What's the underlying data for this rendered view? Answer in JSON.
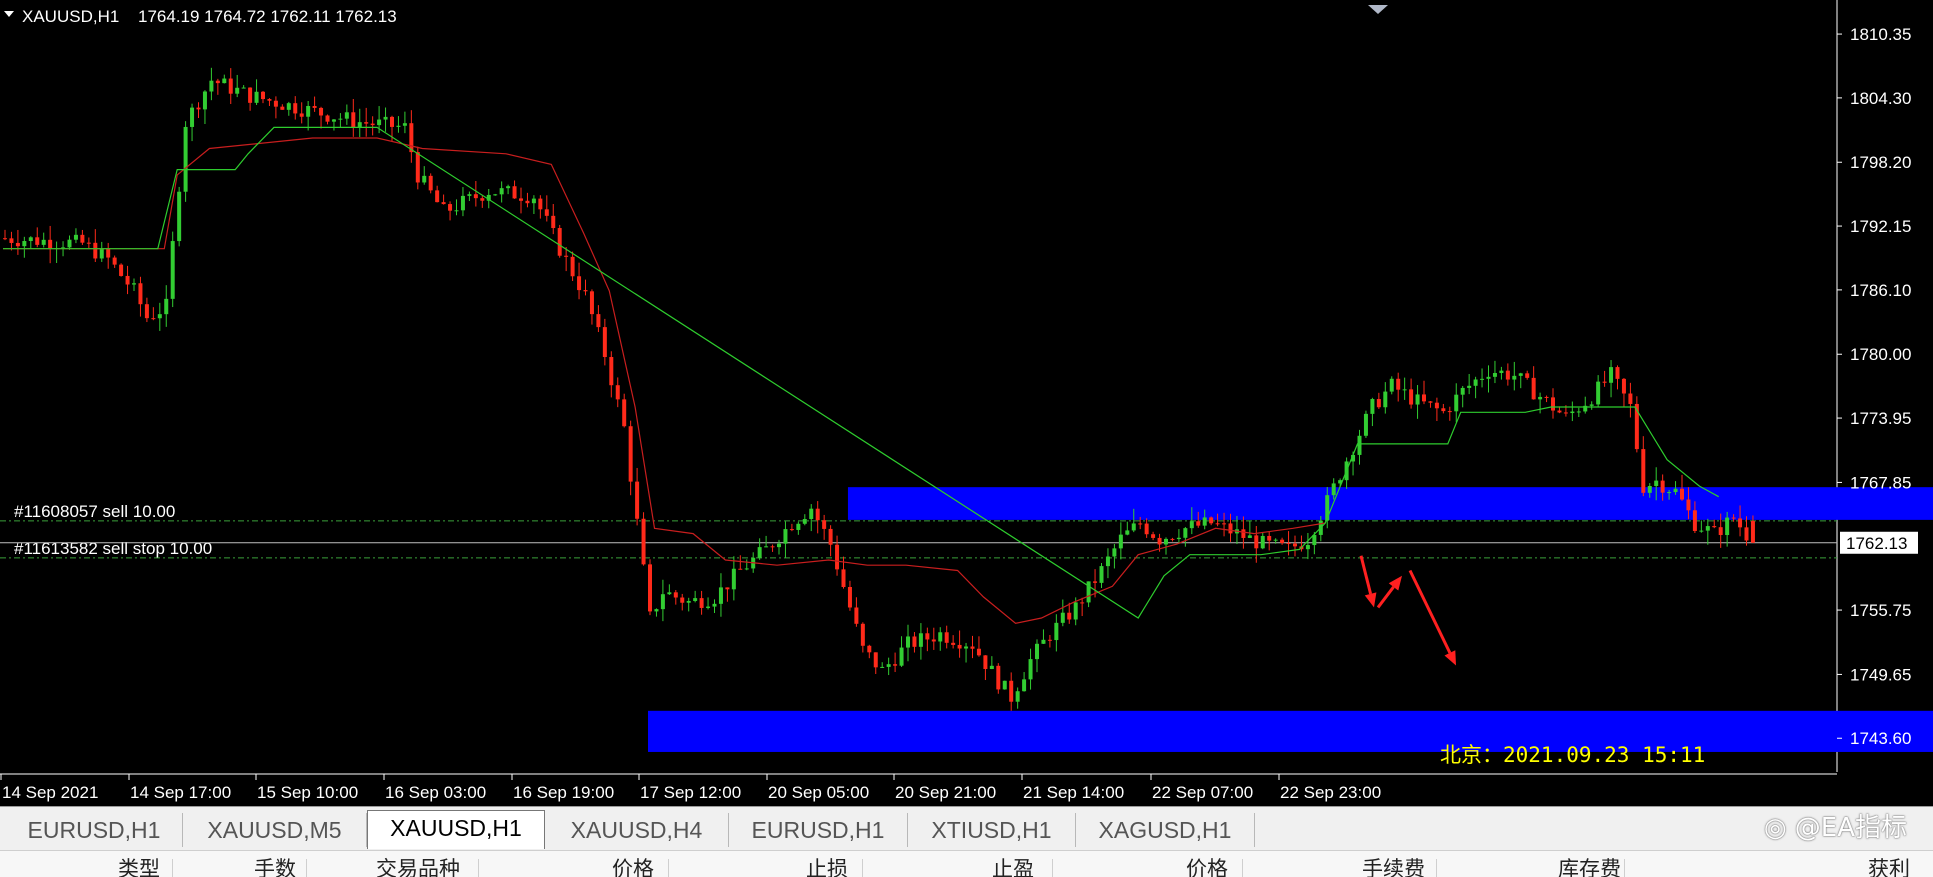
{
  "header": {
    "symbol": "XAUUSD,H1",
    "ohlc": "1764.19 1764.72 1762.11 1762.13"
  },
  "orders": [
    {
      "label": "#11608057 sell 10.00",
      "price": 1764.2
    },
    {
      "label": "#11613582 sell stop 10.00",
      "price": 1760.7
    }
  ],
  "current_price_label": "1762.13",
  "beijing_time": "北京：2021.09.23 15:11",
  "tabs": [
    {
      "label": "EURUSD,H1",
      "active": false
    },
    {
      "label": "XAUUSD,M5",
      "active": false
    },
    {
      "label": "XAUUSD,H1",
      "active": true
    },
    {
      "label": "XAUUSD,H4",
      "active": false
    },
    {
      "label": "EURUSD,H1",
      "active": false
    },
    {
      "label": "XTIUSD,H1",
      "active": false
    },
    {
      "label": "XAGUSD,H1",
      "active": false
    }
  ],
  "watermark": "@EA指标",
  "terminal_columns": [
    "类型",
    "手数",
    "交易品种",
    "价格",
    "止损",
    "止盈",
    "价格",
    "手续费",
    "库存费",
    "获利"
  ],
  "colors": {
    "background": "#000000",
    "bull": "#32cd32",
    "bear": "#ff2a1a",
    "zone": "#0000ff",
    "arrow": "#ff2020",
    "ma_red": "#c81e1e",
    "ma_green": "#2ecc2e"
  },
  "chart_data": {
    "type": "candlestick",
    "symbol": "XAUUSD",
    "timeframe": "H1",
    "ylim": [
      1740.4,
      1813.2
    ],
    "y_ticks": [
      1810.35,
      1804.3,
      1798.2,
      1792.15,
      1786.1,
      1780.0,
      1773.95,
      1767.85,
      1762.13,
      1755.75,
      1749.65,
      1743.6
    ],
    "x_tick_labels": [
      "14 Sep 2021",
      "14 Sep 17:00",
      "15 Sep 10:00",
      "16 Sep 03:00",
      "16 Sep 19:00",
      "17 Sep 12:00",
      "20 Sep 05:00",
      "20 Sep 21:00",
      "21 Sep 14:00",
      "22 Sep 07:00",
      "22 Sep 23:00"
    ],
    "close_path": [
      [
        0,
        1791.0
      ],
      [
        12,
        1790.5
      ],
      [
        16,
        1789.0
      ],
      [
        20,
        1786.0
      ],
      [
        22,
        1783.5
      ],
      [
        25,
        1784.5
      ],
      [
        28,
        1802.0
      ],
      [
        32,
        1806.0
      ],
      [
        38,
        1804.5
      ],
      [
        48,
        1803.0
      ],
      [
        55,
        1802.0
      ],
      [
        62,
        1801.5
      ],
      [
        64,
        1797.0
      ],
      [
        68,
        1793.5
      ],
      [
        75,
        1795.5
      ],
      [
        82,
        1795.0
      ],
      [
        86,
        1790.0
      ],
      [
        90,
        1785.5
      ],
      [
        93,
        1780.0
      ],
      [
        96,
        1773.0
      ],
      [
        98,
        1764.0
      ],
      [
        100,
        1755.0
      ],
      [
        102,
        1757.5
      ],
      [
        106,
        1756.5
      ],
      [
        110,
        1757.0
      ],
      [
        114,
        1759.5
      ],
      [
        118,
        1761.5
      ],
      [
        122,
        1764.0
      ],
      [
        125,
        1765.5
      ],
      [
        128,
        1762.0
      ],
      [
        130,
        1758.0
      ],
      [
        133,
        1752.0
      ],
      [
        136,
        1750.0
      ],
      [
        140,
        1752.5
      ],
      [
        145,
        1753.5
      ],
      [
        150,
        1752.5
      ],
      [
        154,
        1749.0
      ],
      [
        156,
        1747.5
      ],
      [
        159,
        1751.0
      ],
      [
        162,
        1753.5
      ],
      [
        166,
        1756.0
      ],
      [
        170,
        1759.5
      ],
      [
        173,
        1762.5
      ],
      [
        176,
        1764.0
      ],
      [
        179,
        1762.5
      ],
      [
        183,
        1763.5
      ],
      [
        187,
        1764.0
      ],
      [
        191,
        1763.0
      ],
      [
        195,
        1762.0
      ],
      [
        199,
        1761.5
      ],
      [
        202,
        1762.5
      ],
      [
        205,
        1766.0
      ],
      [
        208,
        1770.0
      ],
      [
        212,
        1775.0
      ],
      [
        215,
        1777.0
      ],
      [
        219,
        1775.5
      ],
      [
        223,
        1774.5
      ],
      [
        226,
        1776.5
      ],
      [
        230,
        1778.5
      ],
      [
        234,
        1778.0
      ],
      [
        238,
        1776.0
      ],
      [
        242,
        1774.0
      ],
      [
        246,
        1776.0
      ],
      [
        249,
        1778.0
      ],
      [
        252,
        1775.0
      ],
      [
        254,
        1767.5
      ],
      [
        256,
        1768.0
      ],
      [
        259,
        1767.0
      ],
      [
        262,
        1764.0
      ],
      [
        265,
        1763.0
      ],
      [
        268,
        1764.5
      ],
      [
        271,
        1762.13
      ]
    ],
    "ma_red_path": [
      [
        0,
        1790.0
      ],
      [
        14,
        1790.0
      ],
      [
        25,
        1790.0
      ],
      [
        27,
        1797.0
      ],
      [
        32,
        1799.5
      ],
      [
        48,
        1800.5
      ],
      [
        58,
        1800.5
      ],
      [
        65,
        1799.5
      ],
      [
        78,
        1799.0
      ],
      [
        85,
        1798.0
      ],
      [
        90,
        1791.5
      ],
      [
        94,
        1786.0
      ],
      [
        98,
        1775.0
      ],
      [
        101,
        1763.5
      ],
      [
        107,
        1763.0
      ],
      [
        112,
        1760.5
      ],
      [
        120,
        1760.0
      ],
      [
        128,
        1760.5
      ],
      [
        134,
        1760.0
      ],
      [
        140,
        1760.0
      ],
      [
        148,
        1759.5
      ],
      [
        152,
        1757.0
      ],
      [
        157,
        1754.5
      ],
      [
        161,
        1755.0
      ],
      [
        166,
        1756.5
      ],
      [
        172,
        1758.0
      ],
      [
        176,
        1761.0
      ],
      [
        182,
        1762.0
      ],
      [
        188,
        1763.5
      ],
      [
        194,
        1763.0
      ],
      [
        200,
        1763.5
      ],
      [
        205,
        1764.0
      ]
    ],
    "ma_green_path": [
      [
        0,
        1790.0
      ],
      [
        24,
        1790.0
      ],
      [
        27,
        1797.5
      ],
      [
        36,
        1797.5
      ],
      [
        38,
        1799.0
      ],
      [
        42,
        1801.5
      ],
      [
        58,
        1801.5
      ],
      [
        176,
        1755.0
      ],
      [
        180,
        1759.0
      ],
      [
        184,
        1761.0
      ],
      [
        195,
        1761.0
      ],
      [
        201,
        1761.5
      ],
      [
        205,
        1764.0
      ],
      [
        210,
        1771.5
      ],
      [
        224,
        1771.5
      ],
      [
        226,
        1774.5
      ],
      [
        236,
        1774.5
      ],
      [
        240,
        1775.0
      ],
      [
        253,
        1775.0
      ],
      [
        258,
        1770.0
      ],
      [
        263,
        1767.5
      ],
      [
        266,
        1766.5
      ]
    ],
    "zones": [
      {
        "from": 131,
        "to": 367,
        "top": 1767.4,
        "bottom": 1764.3
      },
      {
        "from": 100,
        "to": 360,
        "top": 1746.2,
        "bottom": 1742.3
      }
    ],
    "annotations": [
      {
        "type": "arrow",
        "points": [
          [
            1101,
            1760.9
          ],
          [
            1112,
            1756.0
          ]
        ]
      },
      {
        "type": "arrow",
        "points": [
          [
            1116,
            1756.0
          ],
          [
            1136,
            1759.0
          ]
        ]
      },
      {
        "type": "arrow",
        "points": [
          [
            1142,
            1759.5
          ],
          [
            1180,
            1750.5
          ]
        ]
      }
    ]
  }
}
